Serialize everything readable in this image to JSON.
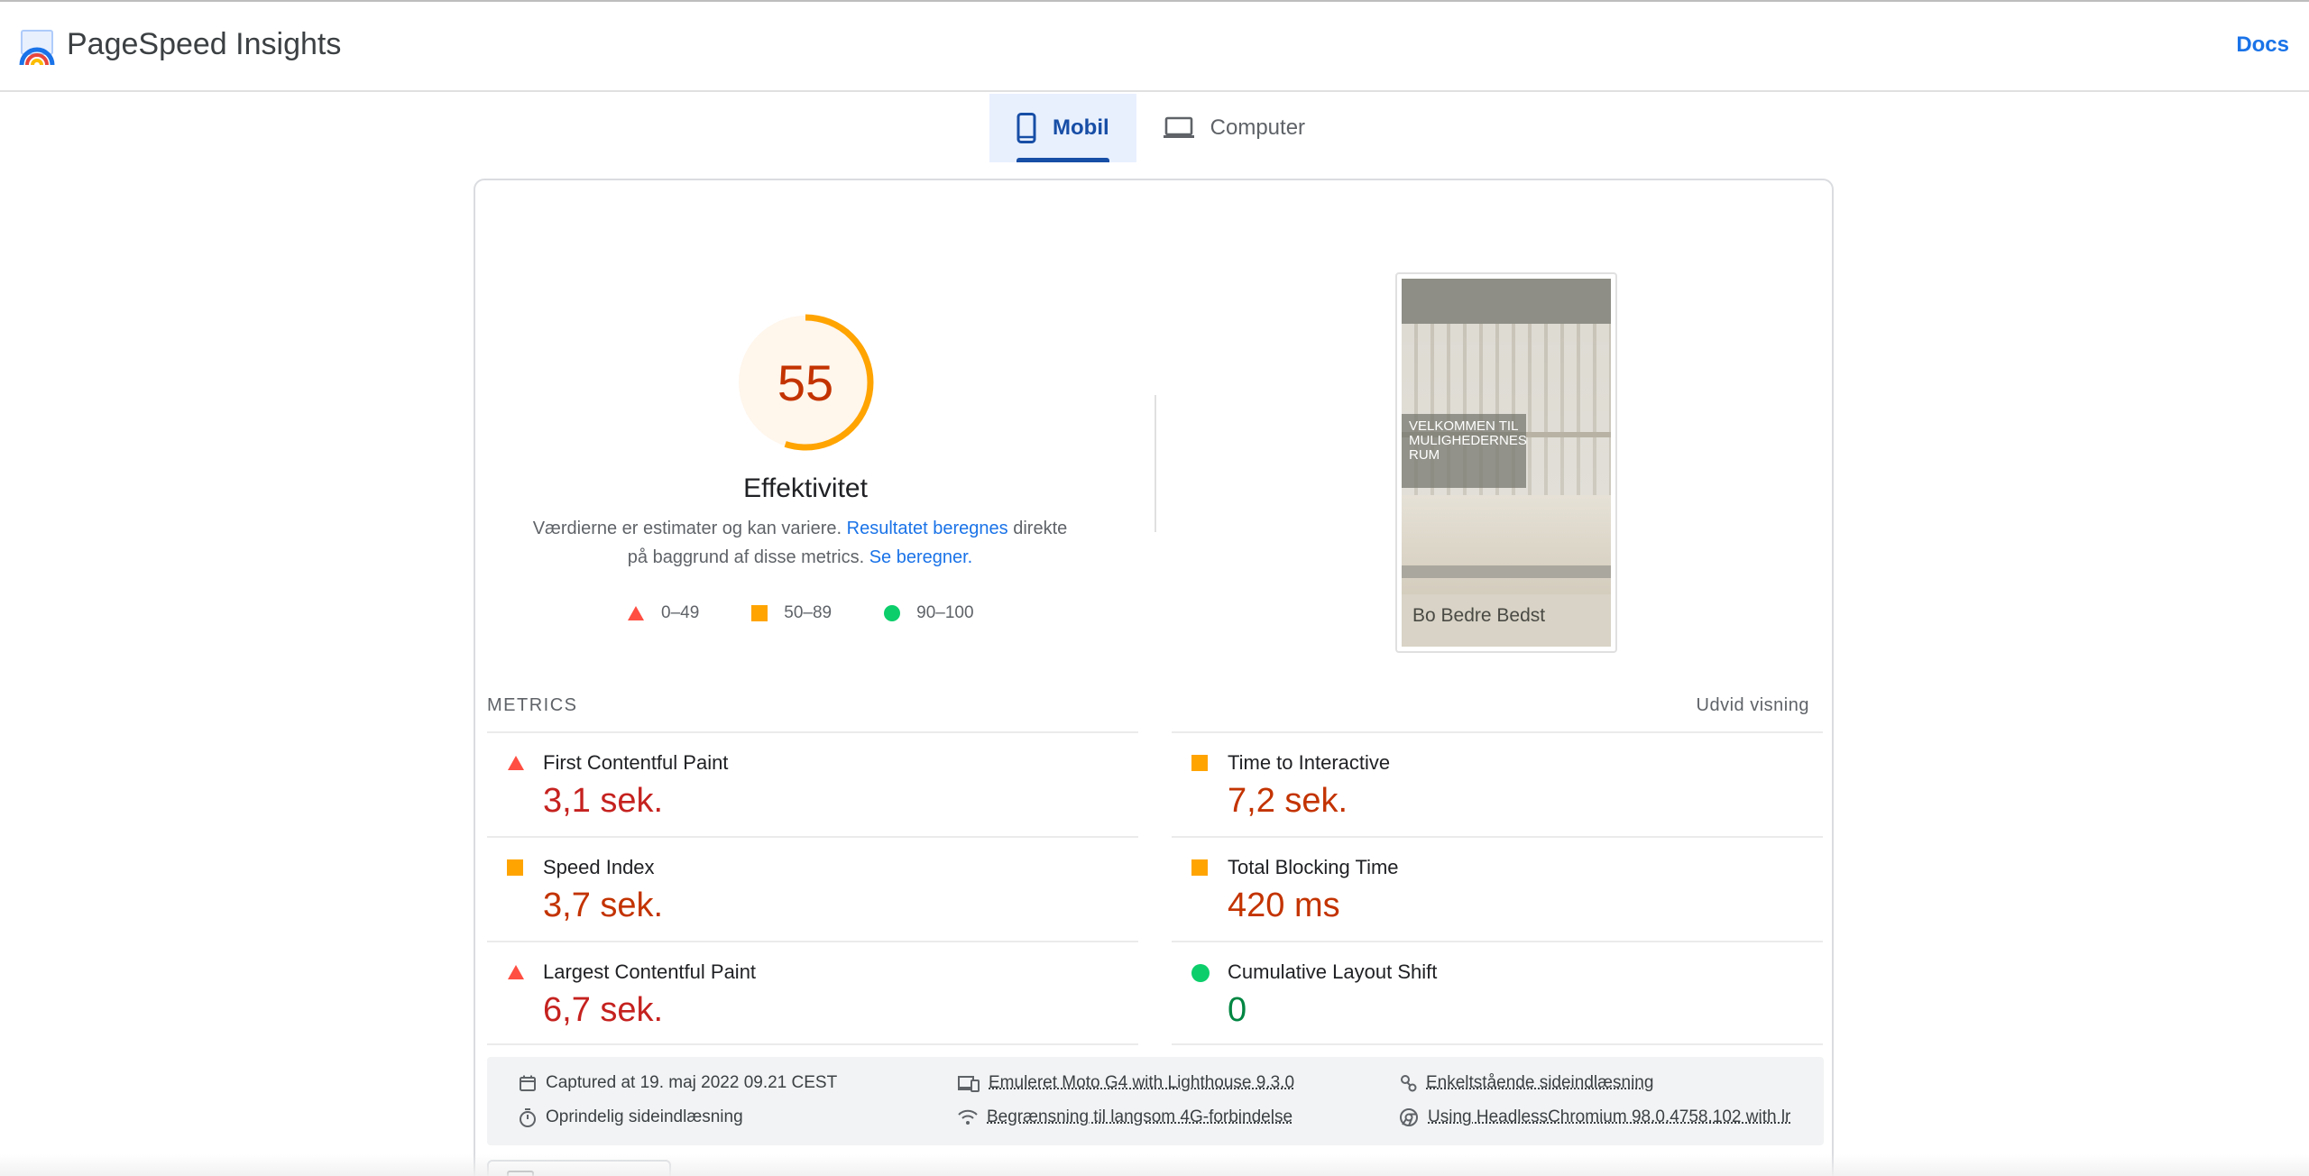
{
  "header": {
    "app_title": "PageSpeed Insights",
    "docs_label": "Docs"
  },
  "tabs": [
    {
      "label": "Mobil",
      "active": true,
      "icon": "smartphone-icon"
    },
    {
      "label": "Computer",
      "active": false,
      "icon": "laptop-icon"
    }
  ],
  "score": {
    "value": "55",
    "fraction": 0.55,
    "category": "Effektivitet",
    "color": "#ffa400"
  },
  "description": {
    "text_1": "Værdierne er estimater og kan variere. ",
    "link_1": "Resultatet beregnes",
    "text_2": " direkte på baggrund af disse metrics. ",
    "link_2": "Se beregner."
  },
  "legend": [
    {
      "range": "0–49",
      "shape": "triangle",
      "color": "#ff4e42"
    },
    {
      "range": "50–89",
      "shape": "square",
      "color": "#ffa400"
    },
    {
      "range": "90–100",
      "shape": "circle",
      "color": "#0cce6b"
    }
  ],
  "thumbnail": {
    "hero_text": "VELKOMMEN TIL MULIGHEDERNES RUM",
    "heading": "Bo Bedre Bedst"
  },
  "metrics": {
    "section_label": "METRICS",
    "expand_label": "Udvid visning",
    "left": [
      {
        "name": "First Contentful Paint",
        "value": "3,1 sek.",
        "rating": "fail"
      },
      {
        "name": "Speed Index",
        "value": "3,7 sek.",
        "rating": "average"
      },
      {
        "name": "Largest Contentful Paint",
        "value": "6,7 sek.",
        "rating": "fail"
      }
    ],
    "right": [
      {
        "name": "Time to Interactive",
        "value": "7,2 sek.",
        "rating": "average"
      },
      {
        "name": "Total Blocking Time",
        "value": "420 ms",
        "rating": "average"
      },
      {
        "name": "Cumulative Layout Shift",
        "value": "0",
        "rating": "pass"
      }
    ]
  },
  "runtime": {
    "captured": "Captured at 19. maj 2022 09.21 CEST",
    "initial_load": "Oprindelig sideindlæsning",
    "emulated": "Emuleret Moto G4 with Lighthouse 9.3.0",
    "throttling": "Begrænsning til langsom 4G-forbindelse",
    "single_load": "Enkeltstående sideindlæsning",
    "browser": "Using HeadlessChromium 98.0.4758.102 with lr"
  }
}
